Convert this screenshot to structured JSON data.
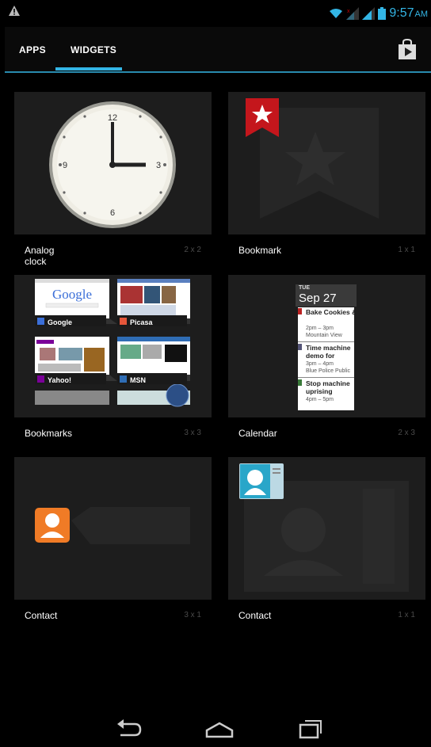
{
  "status_bar": {
    "time": "9:57",
    "ampm": "AM",
    "icons": [
      "warning-icon",
      "wifi-icon",
      "signal-icon",
      "signal-icon",
      "battery-icon"
    ],
    "accent_color": "#33b5e5"
  },
  "tabs": {
    "items": [
      {
        "label": "APPS",
        "selected": false
      },
      {
        "label": "WIDGETS",
        "selected": true
      }
    ],
    "store_icon": "play-store-icon"
  },
  "widgets": [
    {
      "name": "Analog clock",
      "size": "2 x 2",
      "preview": "analog-clock"
    },
    {
      "name": "Bookmark",
      "size": "1 x 1",
      "preview": "bookmark-star"
    },
    {
      "name": "Bookmarks",
      "size": "3 x 3",
      "preview": "bookmarks-thumbnails",
      "thumbnails": [
        "Google",
        "Picasa",
        "Yahoo!",
        "MSN"
      ],
      "google_logo": "Google"
    },
    {
      "name": "Calendar",
      "size": "2 x 3",
      "preview": "calendar",
      "calendar": {
        "day": "TUE",
        "date": "Sep 27",
        "events": [
          {
            "title": "Bake Cookies & Make Ice Cream",
            "time": "2pm – 3pm",
            "location": "Mountain View"
          },
          {
            "title": "Time machine demo for Sergey",
            "time": "3pm – 4pm",
            "location": "Blue Police Public"
          },
          {
            "title": "Stop machine uprising",
            "time": "4pm – 5pm",
            "location": ""
          }
        ]
      }
    },
    {
      "name": "Contact",
      "size": "3 x 1",
      "preview": "contact-orange"
    },
    {
      "name": "Contact",
      "size": "1 x 1",
      "preview": "contact-blue"
    }
  ],
  "nav_bar": {
    "buttons": [
      "back-icon",
      "home-icon",
      "recent-apps-icon"
    ]
  }
}
